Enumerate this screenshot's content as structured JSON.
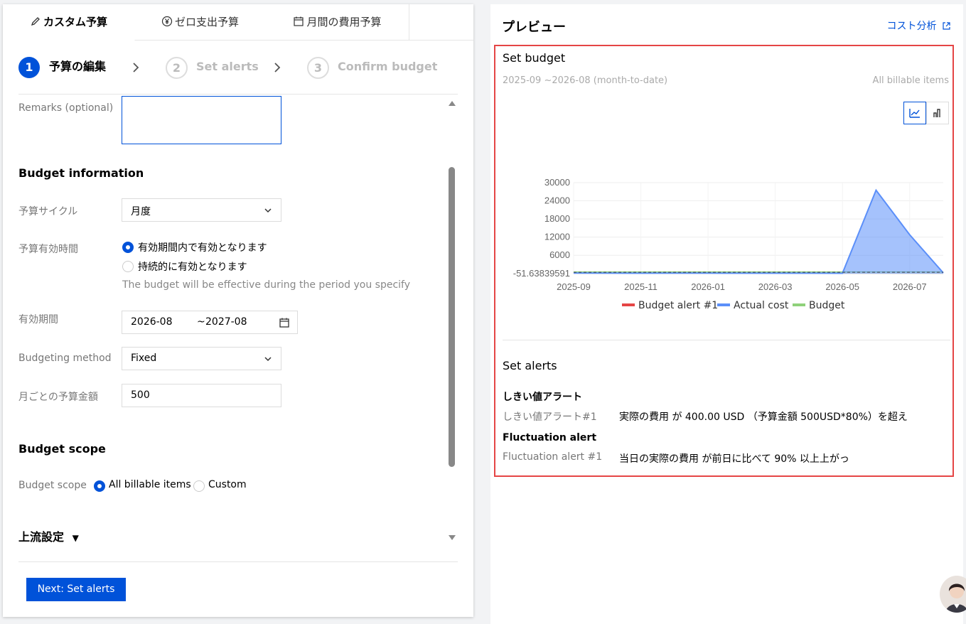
{
  "tabs": [
    {
      "label": "カスタム予算",
      "icon": "pencil-icon"
    },
    {
      "label": "ゼロ支出予算",
      "icon": "yen-circle-icon"
    },
    {
      "label": "月間の費用予算",
      "icon": "calendar-icon"
    }
  ],
  "steps": [
    {
      "num": "1",
      "label": "予算の編集"
    },
    {
      "num": "2",
      "label": "Set alerts"
    },
    {
      "num": "3",
      "label": "Confirm budget"
    }
  ],
  "form": {
    "remarks_label": "Remarks (optional)",
    "remarks_value": "",
    "budget_info_title": "Budget information",
    "cycle_label": "予算サイクル",
    "cycle_value": "月度",
    "validity_label": "予算有効時間",
    "validity_opt1": "有効期間内で有効となります",
    "validity_opt2": "持続的に有効となります",
    "validity_hint": "The budget will be effective during the period you specify",
    "period_label": "有効期間",
    "period_start": "2026-08",
    "period_sep": "~",
    "period_end": "2027-08",
    "method_label": "Budgeting method",
    "method_value": "Fixed",
    "amount_label": "月ごとの予算金額",
    "amount_value": "500",
    "scope_title": "Budget scope",
    "scope_label": "Budget scope",
    "scope_opt1": "All billable items",
    "scope_opt2": "Custom",
    "upstream_title": "上流設定",
    "next_button": "Next: Set alerts"
  },
  "preview": {
    "title": "プレビュー",
    "cost_link": "コスト分析",
    "set_budget": "Set budget",
    "period": "2025-09 ~2026-08 (month-to-date)",
    "scope": "All billable items",
    "set_alerts": "Set alerts",
    "threshold_title": "しきい値アラート",
    "threshold_label": "しきい値アラート#1",
    "threshold_text": "実際の費用 が 400.00 USD （予算金額 500USD*80%）を超え",
    "fluct_title": "Fluctuation alert",
    "fluct_label": "Fluctuation alert #1",
    "fluct_text": "当日の実際の費用 が前日に比べて 90% 以上上がっ"
  },
  "colors": {
    "accent": "#0052d9",
    "alert_red": "#e54545",
    "actual_blue": "#5b8ff9",
    "budget_green": "#8fd17a"
  },
  "chart_data": {
    "type": "area",
    "x": [
      "2025-09",
      "2025-10",
      "2025-11",
      "2025-12",
      "2026-01",
      "2026-02",
      "2026-03",
      "2026-04",
      "2026-05",
      "2026-06",
      "2026-07",
      "2026-08"
    ],
    "x_tick_labels": [
      "2025-09",
      "2025-11",
      "2026-01",
      "2026-03",
      "2026-05",
      "2026-07"
    ],
    "y_tick_labels": [
      "30000",
      "24000",
      "18000",
      "12000",
      "6000",
      "-51.63839591"
    ],
    "ylim": [
      -51.63839591,
      30000
    ],
    "series": [
      {
        "name": "Budget alert #1",
        "color": "#e54545",
        "values": [
          400,
          400,
          400,
          400,
          400,
          400,
          400,
          400,
          400,
          400,
          400,
          400
        ]
      },
      {
        "name": "Actual cost",
        "color": "#5b8ff9",
        "values": [
          150,
          120,
          100,
          130,
          110,
          100,
          100,
          90,
          80,
          27500,
          12800,
          200
        ]
      },
      {
        "name": "Budget",
        "color": "#8fd17a",
        "values": [
          500,
          500,
          500,
          500,
          500,
          500,
          500,
          500,
          500,
          500,
          500,
          500
        ]
      }
    ],
    "grid": true,
    "legend": "bottom"
  }
}
